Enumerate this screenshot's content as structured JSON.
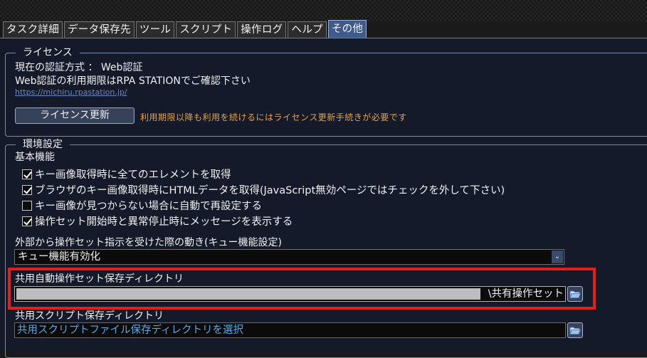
{
  "tabs": [
    {
      "label": "タスク詳細"
    },
    {
      "label": "データ保存先"
    },
    {
      "label": "ツール"
    },
    {
      "label": "スクリプト"
    },
    {
      "label": "操作ログ"
    },
    {
      "label": "ヘルプ"
    },
    {
      "label": "その他",
      "active": true
    }
  ],
  "license": {
    "legend": "ライセンス",
    "auth_method": "現在の認証方式 ： Web認証",
    "validity_note": "Web認証の利用期限はRPA STATIONでご確認下さい",
    "link": "https://michiru.rpastation.jp/",
    "update_button": "ライセンス更新",
    "update_note": "利用期限以降も利用を続けるにはライセンス更新手続きが必要です"
  },
  "env": {
    "legend": "環境設定",
    "basic_label": "基本機能",
    "checkboxes": [
      {
        "label": "キー画像取得時に全てのエレメントを取得",
        "checked": true
      },
      {
        "label": "ブラウザのキー画像取得時にHTMLデータを取得(JavaScript無効ページではチェックを外して下さい)",
        "checked": true
      },
      {
        "label": "キー画像が見つからない場合に自動で再設定する",
        "checked": false
      },
      {
        "label": "操作セット開始時と異常停止時にメッセージを表示する",
        "checked": true
      }
    ],
    "queue_label": "外部から操作セット指示を受けた際の動き(キュー機能設定)",
    "queue_value": "キュー機能有効化",
    "shared_dir_label": "共用自動操作セット保存ディレクトリ",
    "shared_dir_value": "\\共有操作セット",
    "script_dir_label": "共用スクリプト保存ディレクトリ",
    "script_dir_placeholder": "共用スクリプトファイル保存ディレクトリを選択"
  },
  "colors": {
    "accent_tab": "#3f5a8c",
    "note_orange": "#e8a040",
    "placeholder_blue": "#5aa8e6",
    "highlight_red": "#e0201c"
  },
  "icons": {
    "checkbox": "check-icon",
    "dropdown": "chevron-down-icon",
    "folder": "folder-open-icon"
  }
}
